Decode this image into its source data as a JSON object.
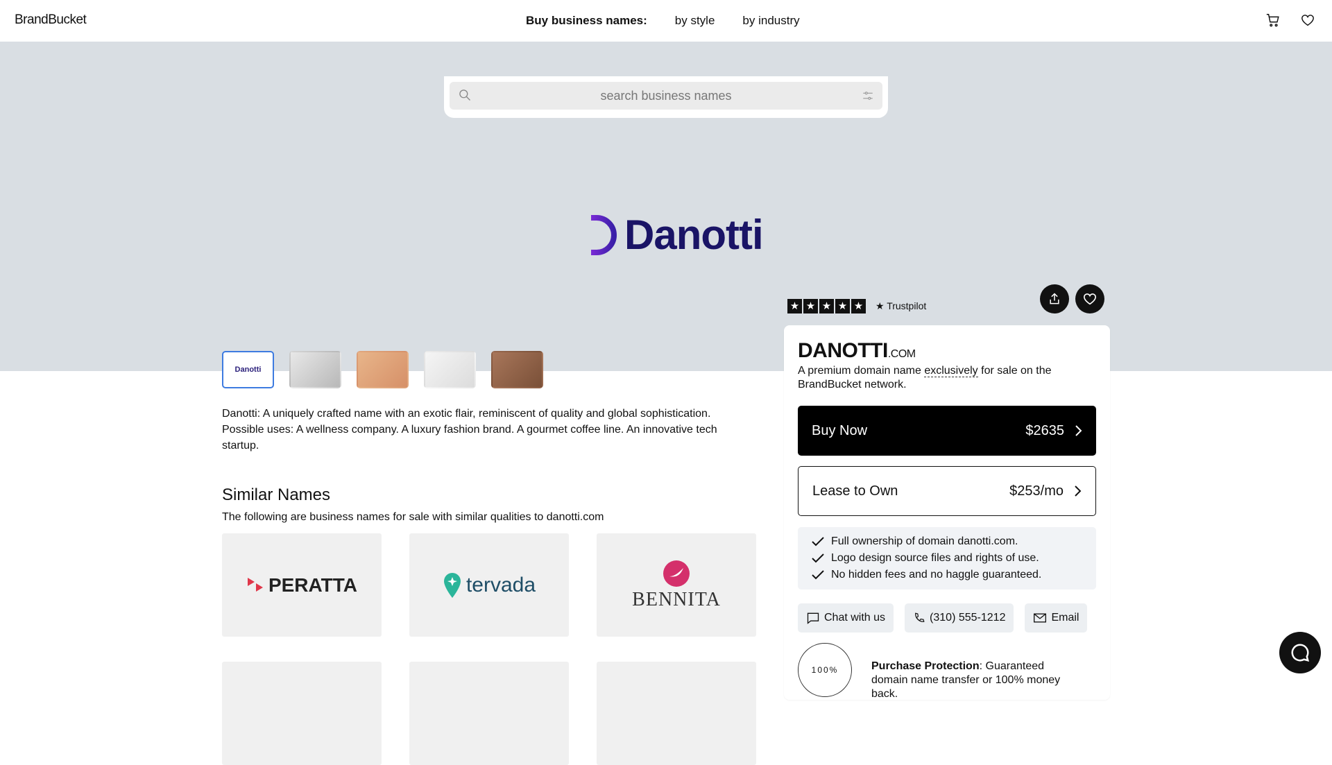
{
  "header": {
    "brand": "BrandBucket",
    "nav_lead": "Buy business names:",
    "nav_style": "by style",
    "nav_industry": "by industry",
    "cart_icon": "cart-icon",
    "heart_icon": "heart-icon"
  },
  "search": {
    "placeholder": "search business names"
  },
  "hero": {
    "logo_text": "Danotti",
    "thumbnail_active_label": "Danotti"
  },
  "trustpilot": {
    "label": "Trustpilot",
    "stars": 5
  },
  "domain": {
    "name": "DANOTTI",
    "tld": ".COM",
    "sub_before": "A premium domain name ",
    "sub_emph": "exclusively",
    "sub_after": " for sale on the BrandBucket network.",
    "buy_label": "Buy Now",
    "buy_price": "$2635",
    "lease_label": "Lease to Own",
    "lease_price": "$253/mo",
    "features": [
      "Full ownership of domain danotti.com.",
      "Logo design source files and rights of use.",
      "No hidden fees and no haggle guaranteed."
    ],
    "chat_label": "Chat with us",
    "phone_label": "(310) 555-1212",
    "email_label": "Email",
    "seal_text": "100%",
    "protection_title": "Purchase Protection",
    "protection_text": ": Guaranteed domain name transfer or 100% money back."
  },
  "description": "Danotti: A uniquely crafted name with an exotic flair, reminiscent of quality and global sophistication. Possible uses: A wellness company. A luxury fashion brand. A gourmet coffee line. An innovative tech startup.",
  "similar": {
    "heading": "Similar Names",
    "subheading": "The following are business names for sale with similar qualities to danotti.com",
    "items": [
      {
        "name": "PERATTA",
        "color": "#222222",
        "accent": "#e0374a"
      },
      {
        "name": "tervada",
        "color": "#1e4d66",
        "accent": "#2bb59a"
      },
      {
        "name": "BENNITA",
        "color": "#333333",
        "accent": "#d4306b"
      }
    ]
  }
}
